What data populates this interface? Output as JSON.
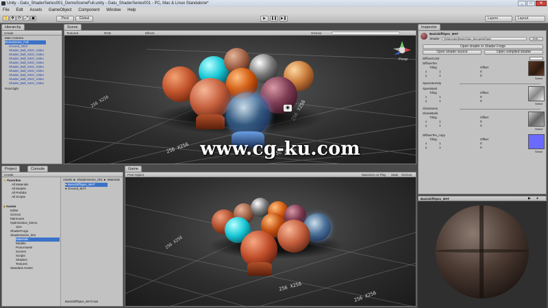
{
  "window": {
    "title": "Unity - Gatu_ShaderSeries001_DemoSceneFull.unity - Gatu_ShaderSeries001 - PC, Mac & Linux Standalone*"
  },
  "menu": [
    "File",
    "Edit",
    "Assets",
    "GameObject",
    "Component",
    "Window",
    "Help"
  ],
  "toolbar": {
    "pivot_label": "Pivot",
    "global_label": "Global",
    "play_icon": "▶",
    "pause_icon": "❚❚",
    "step_icon": "▶❚",
    "layers_label": "Layers",
    "layout_label": "Layout"
  },
  "hierarchy": {
    "tab": "Hierarchy",
    "create_label": "Create",
    "items": [
      "Main Camera",
      "DemoScene_Full",
      "Ground_GEO",
      "Shader_Ball_GEO_Video",
      "Shader_Ball_GEO_Video",
      "Shader_Ball_GEO_Video",
      "Shader_Ball_GEO_Video",
      "Shader_Ball_GEO_Video",
      "Shader_Ball_GEO_Video",
      "Shader_Ball_GEO_Video",
      "Shader_Ball_GEO_Video",
      "Shader_Ball_GEO_Video",
      "Point light"
    ]
  },
  "scene": {
    "tab": "Scene",
    "shading_mode": "Textured",
    "rgb_label": "RGB",
    "effects_label": "Effects",
    "gizmos_label": "Gizmos",
    "persp_label": "Persp",
    "floor_marks": [
      "256 X256",
      "256 X256",
      "256 X256",
      "256 X256"
    ]
  },
  "watermark": "www.cg-ku.com",
  "project": {
    "tab": "Project",
    "console_tab": "Console",
    "create_label": "Create",
    "favorites_label": "Favorites",
    "favorites": [
      "All Materials",
      "All Models",
      "All Prefabs",
      "All Scripts"
    ],
    "assets_label": "Assets",
    "assets": [
      "Editor",
      "Gizmos",
      "Marmoset",
      "Optimization_Demo",
      "Size",
      "ShaderForge",
      "ShaderSeries_001",
      "Materials",
      "Models",
      "ProtoAssets",
      "Scenes",
      "Scripts",
      "Shaders",
      "Textures",
      "Standard Assets"
    ],
    "breadcrumb": "Assets ► ShaderSeries_001 ► Materials",
    "files": [
      "BasicDiffSpec_MAT",
      "Ground_MAT"
    ],
    "footer": "BasicDiffSpec_MAT.mat"
  },
  "game": {
    "tab": "Game",
    "aspect": "Free Aspect",
    "maximize_label": "Maximize on Play",
    "stats_label": "Stats",
    "gizmos_label": "Gizmos",
    "floor_marks": [
      "256 X256",
      "256 X256",
      "256 X256"
    ]
  },
  "inspector": {
    "tab": "Inspector",
    "material_name": "BasicDiffSpec_MAT",
    "shader_label": "Shader",
    "shader_value": "Relaborate/Basic/Gatu_Bumped&Spec",
    "edit_label": "Edit...",
    "open_forge": "Open shader in Shader Forge",
    "open_source": "Open shader source",
    "open_compiled": "Open compiled shader",
    "props": [
      {
        "label": "DiffuseColor",
        "type": "color"
      },
      {
        "label": "DiffuseTex",
        "tiling_label": "Tiling",
        "offset_label": "Offset",
        "x_label": "x",
        "y_label": "y",
        "x": "1",
        "y": "1",
        "ox": "0",
        "oy": "0",
        "select": "Select"
      },
      {
        "label": "SpecIntensity",
        "type": "slider"
      },
      {
        "label": "SpecMask",
        "tiling_label": "Tiling",
        "offset_label": "Offset",
        "x_label": "x",
        "y_label": "y",
        "x": "1",
        "y": "1",
        "ox": "0",
        "oy": "0",
        "select": "Select"
      },
      {
        "label": "Glossiness",
        "type": "slider"
      },
      {
        "label": "GlossMask",
        "tiling_label": "Tiling",
        "offset_label": "Offset",
        "x_label": "x",
        "y_label": "y",
        "x": "1",
        "y": "1",
        "ox": "0",
        "oy": "0",
        "select": "Select"
      },
      {
        "label": "DiffuseTex_copy",
        "tiling_label": "Tiling",
        "offset_label": "Offset",
        "x_label": "x",
        "y_label": "y",
        "x": "1",
        "y": "1",
        "ox": "0",
        "oy": "0",
        "select": "Select"
      }
    ],
    "preview_label": "BasicDiffSpec_MAT"
  },
  "colors": {
    "selection": "#3a72c8",
    "panel": "#c2c2c2",
    "accent_blue": "#1a3fb0"
  }
}
